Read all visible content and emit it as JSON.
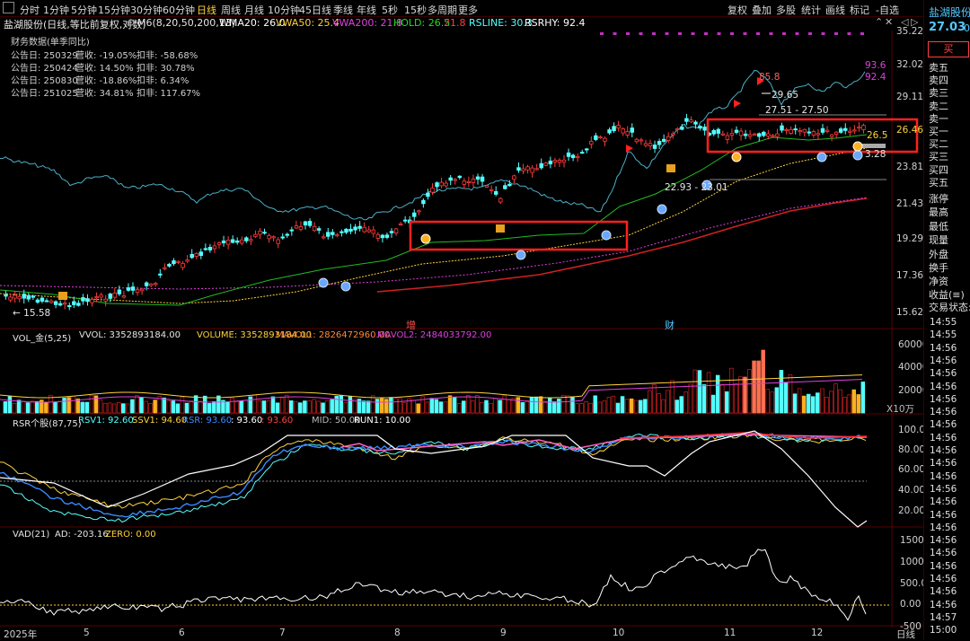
{
  "toolbar": {
    "tabs": [
      "分时",
      "1分钟",
      "5分钟",
      "15分钟",
      "30分钟",
      "60分钟",
      "日线",
      "周线",
      "月线",
      "10分钟",
      "45日线",
      "季线",
      "年线",
      "5秒",
      "15秒",
      "多周期",
      "更多"
    ],
    "active_index": 6,
    "right_buttons": [
      "复权",
      "叠加",
      "多股",
      "统计",
      "画线",
      "标记",
      "-自选"
    ]
  },
  "stock": {
    "name": "盐湖股份",
    "price": "27.03",
    "price_tail": "0.",
    "buy_label": "买"
  },
  "info": {
    "title": "盐湖股份(日线,等比前复权,对数)",
    "m6": "M6(8,20,50,200,13)",
    "wma20": "WMA20: 26.0",
    "vwa50": "VWA50: 25.4",
    "vwa200": "VWA200: 21.8",
    "hold": "HOLD: 26.5",
    "hold_v": "21.8",
    "rsline": "RSLINE: 30.3",
    "rsrhy": "RSRHY: 92.4"
  },
  "financial": {
    "title": "财务数据(单季同比)",
    "rows": [
      {
        "date": "公告日: 250329",
        "rev": "营收:  -19.05%",
        "np": "扣非:  -58.68%"
      },
      {
        "date": "公告日: 250424",
        "rev": "营收:  14.50%",
        "np": "扣非:  30.78%"
      },
      {
        "date": "公告日: 250830",
        "rev": "营收:  -18.86%",
        "np": "扣非:  6.34%"
      },
      {
        "date": "公告日: 251025",
        "rev": "营收:  34.81%",
        "np": "扣非:  117.67%"
      }
    ]
  },
  "price_axis": [
    "35.22",
    "32.02",
    "29.11",
    "26.46",
    "23.81",
    "21.43",
    "19.29",
    "17.36",
    "15.62"
  ],
  "price_axis_highlight": "26.46",
  "annotations": {
    "low": "15.58",
    "high": "85.8",
    "p2965": "29.65",
    "range": "27.51 - 27.50",
    "r93": "93.6",
    "r92": "92.4",
    "hold": "26.5",
    "lvl": "3.28",
    "range2": "22.93 - 23.01",
    "tag_zeng": "增",
    "tag_cai": "财"
  },
  "volume": {
    "legend": [
      "VOL_金(5,25)",
      "VVOL: 3352893184.00",
      "VOLUME: 3352893184.00",
      "MAVOL1: 2826472960.00",
      "MAVOL2: 2484033792.00"
    ],
    "axis": [
      "60000",
      "40000",
      "20000"
    ],
    "unit": "X10万"
  },
  "rsr": {
    "legend": [
      "RSR个股(87,75)",
      "RSV1: 92.60",
      "SSV1: 94.60",
      "RSR: 93.60",
      ": 93.60",
      ": 93.60",
      "MID: 50.00",
      "RUN1: 10.00"
    ],
    "axis": [
      "100.0",
      "80.00",
      "60.00",
      "40.00",
      "20.00"
    ]
  },
  "vad": {
    "legend": [
      "VAD(21)",
      "AD: -203.16",
      "ZERO: 0.00"
    ],
    "axis": [
      "1500",
      "1000",
      "500.00",
      "0.00",
      "-500"
    ]
  },
  "x_axis": [
    "2025年",
    "5",
    "6",
    "7",
    "8",
    "9",
    "10",
    "11",
    "12",
    "日线"
  ],
  "order_book": [
    "卖五",
    "卖四",
    "卖三",
    "卖二",
    "卖一",
    "买一",
    "买二",
    "买三",
    "买四",
    "买五"
  ],
  "stats": [
    "涨停",
    "最高",
    "最低",
    "现量",
    "外盘"
  ],
  "stats2": [
    "换手",
    "净资",
    "收益(≡)",
    "交易状态:"
  ],
  "times": [
    "14:55",
    "14:55",
    "14:56",
    "14:56",
    "14:56",
    "14:56",
    "14:56",
    "14:56",
    "14:56",
    "14:56",
    "14:56",
    "14:56",
    "14:56",
    "14:56",
    "14:56",
    "14:56",
    "14:56",
    "14:56",
    "14:56",
    "14:56",
    "14:56",
    "14:56",
    "14:56",
    "14:57",
    "15:00"
  ],
  "colors": {
    "up": "#ff3b3b",
    "down": "#54ffff",
    "yellow": "#ffd23a",
    "magenta": "#e040e0",
    "green": "#22dd22"
  }
}
